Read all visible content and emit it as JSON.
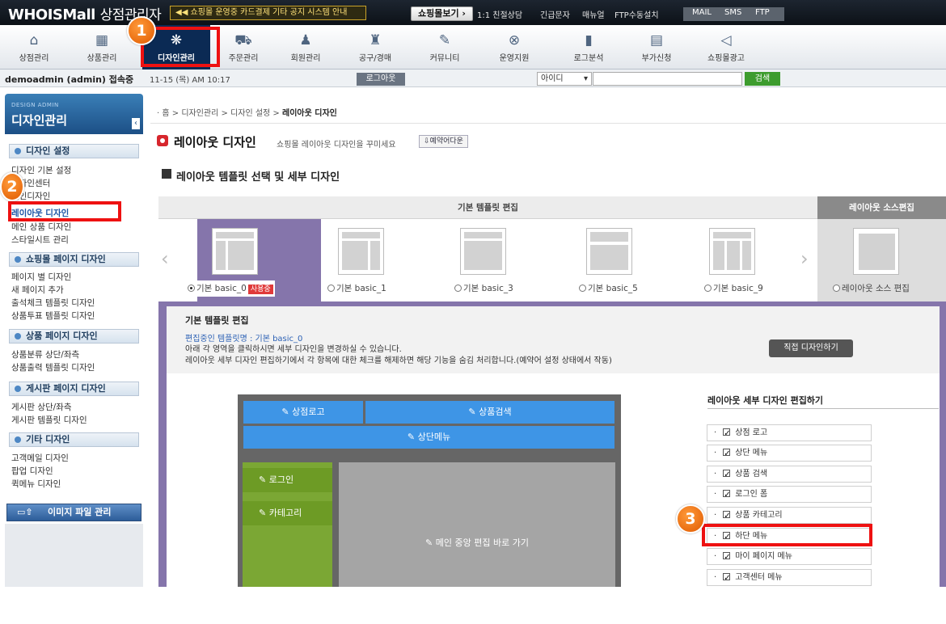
{
  "topbar": {
    "logo_brand": "WHOISMall",
    "logo_suffix": "상점관리자",
    "ticker": "◀◀ 쇼핑몰 운영중 카드결제 기타 공지 시스템 안내",
    "shop_view": "쇼핑몰보기 ›",
    "links": [
      "1:1 친절상담",
      "긴급문자",
      "매뉴얼",
      "FTP수동설치"
    ],
    "pills": [
      "MAIL",
      "SMS",
      "FTP"
    ]
  },
  "nav": [
    {
      "label": "상점관리",
      "icon": "home-icon",
      "glyph": "⌂"
    },
    {
      "label": "상품관리",
      "icon": "goods-icon",
      "glyph": "▦"
    },
    {
      "label": "디자인관리",
      "icon": "design-icon",
      "glyph": "❋"
    },
    {
      "label": "주문관리",
      "icon": "cart-icon",
      "glyph": "⛟"
    },
    {
      "label": "회원관리",
      "icon": "member-icon",
      "glyph": "♟"
    },
    {
      "label": "공구/경매",
      "icon": "auction-icon",
      "glyph": "♜"
    },
    {
      "label": "커뮤니티",
      "icon": "pen-icon",
      "glyph": "✎"
    },
    {
      "label": "운영지원",
      "icon": "support-icon",
      "glyph": "⊗"
    },
    {
      "label": "로그분석",
      "icon": "chart-icon",
      "glyph": "▮"
    },
    {
      "label": "부가신청",
      "icon": "form-icon",
      "glyph": "▤"
    },
    {
      "label": "쇼핑몰광고",
      "icon": "speaker-icon",
      "glyph": "◁"
    }
  ],
  "status": {
    "admin": "demoadmin (admin) 접속중",
    "clock": "11-15 (목) AM 10:17",
    "logout": "로그아웃",
    "search_select": "아이디",
    "search_button": "검색"
  },
  "sidebar": {
    "head_en": "DESIGN ADMIN",
    "head_kr": "디자인관리",
    "sec1": "디자인 설정",
    "sec1_items": [
      "디자인 기본 설정",
      "디자인센터",
      "메인디자인",
      "레이아웃 디자인",
      "메인 상품 디자인",
      "스타일시트 관리"
    ],
    "sec2": "쇼핑몰 페이지 디자인",
    "sec2_items": [
      "페이지 별 디자인",
      "새 페이지 추가",
      "출석체크 템플릿 디자인",
      "상품투표 템플릿 디자인"
    ],
    "sec3": "상품 페이지 디자인",
    "sec3_items": [
      "상품분류 상단/좌측",
      "상품출력 템플릿 디자인"
    ],
    "sec4": "게시판 페이지 디자인",
    "sec4_items": [
      "게시판 상단/좌측",
      "게시판 템플릿 디자인"
    ],
    "sec5": "기타 디자인",
    "sec5_items": [
      "고객메일 디자인",
      "팝업 디자인",
      "퀵메뉴 디자인"
    ],
    "image_btn": "이미지 파일 관리"
  },
  "main": {
    "breadcrumb": [
      "홈",
      "디자인관리",
      "디자인 설정",
      "레이아웃 디자인"
    ],
    "title": "레이아웃 디자인",
    "subtitle": "쇼핑몰 레이아웃 디자인을 꾸미세요",
    "reserve_btn": "예약어다운",
    "section_title": "레이아웃 템플릿 선택 및 세부 디자인",
    "tpl_bar": "기본 템플릿 편집",
    "src_bar": "레이아웃 소스편집",
    "templates": [
      "기본 basic_0",
      "기본 basic_1",
      "기본 basic_3",
      "기본 basic_5",
      "기본 basic_9"
    ],
    "in_use": "사용중",
    "src_option": "레이아웃 소스 편집",
    "edit_title": "기본 템플릿 편집",
    "edit_name": "편집중인 템플릿명 : 기본 basic_0",
    "edit_desc1": "아래 각 영역을 클릭하시면 세부 디자인을 변경하실 수 있습니다.",
    "edit_desc2": "레이아웃 세부 디자인 편집하기에서 각 항목에 대한 체크를 해제하면 해당 기능을 숨김 처리합니다.(예약어 설정 상태에서 작동)",
    "direct_btn": "직접 디자인하기",
    "map": {
      "logo": "상점로고",
      "search": "상품검색",
      "top_menu": "상단메뉴",
      "login": "로그인",
      "category": "카테고리",
      "center": "메인 중앙 편집 바로 가기"
    },
    "checklist_title": "레이아웃 세부 디자인 편집하기",
    "checklist": [
      "상점 로고",
      "상단 메뉴",
      "상품 검색",
      "로그인 폼",
      "상품 카테고리",
      "하단 메뉴",
      "마이 페이지 메뉴",
      "고객센터 메뉴"
    ]
  },
  "annotations": [
    "1",
    "2",
    "3"
  ]
}
